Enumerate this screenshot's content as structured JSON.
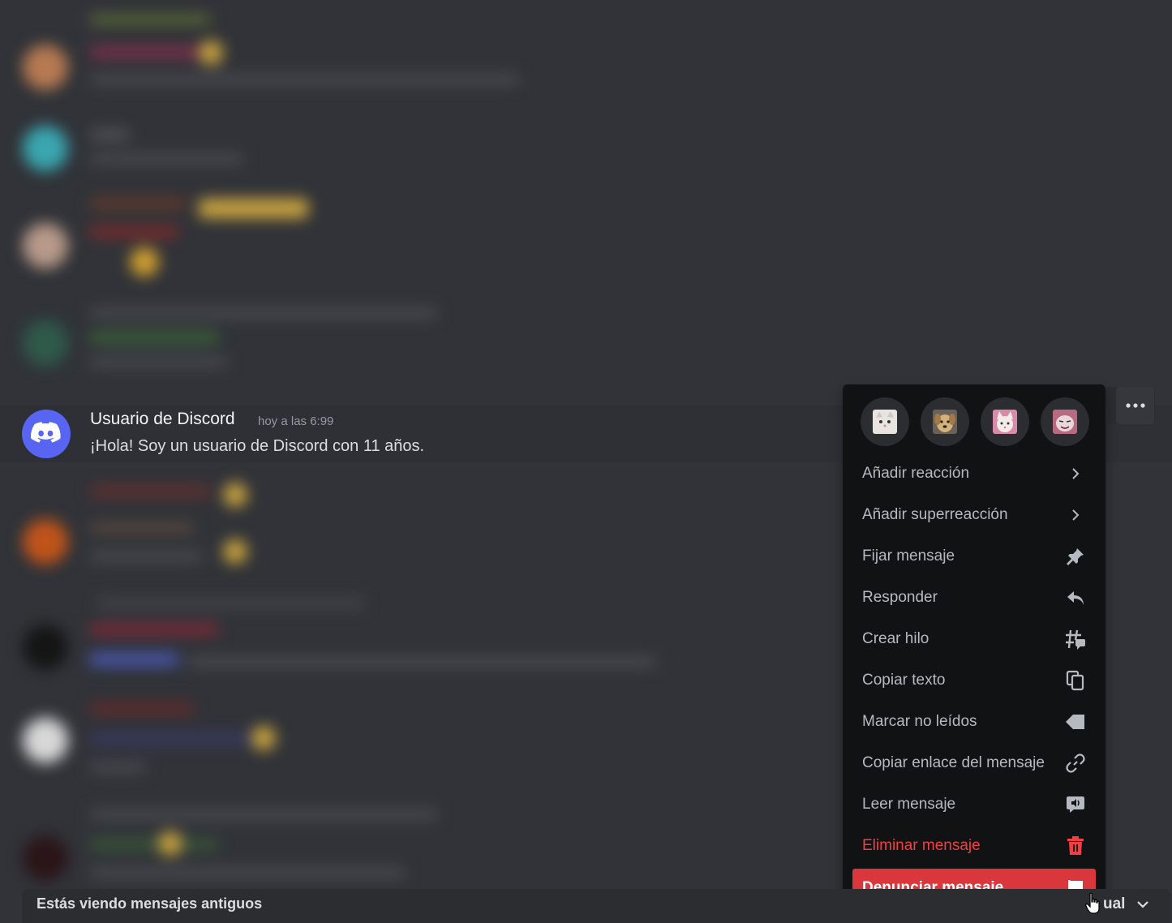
{
  "message": {
    "username": "Usuario de Discord",
    "timestamp": "hoy a las 6:99",
    "text": "¡Hola! Soy un usuario de Discord con 11 años."
  },
  "toolbar": {
    "more_icon": "more-dots-icon"
  },
  "context_menu": {
    "reactions": [
      {
        "icon": "cat-face-emoji"
      },
      {
        "icon": "dog-emoji"
      },
      {
        "icon": "cat-sticker-emoji"
      },
      {
        "icon": "cat-smirk-emoji"
      }
    ],
    "items": [
      {
        "label": "Añadir reacción",
        "icon": "chevron-right-icon"
      },
      {
        "label": "Añadir superreacción",
        "icon": "chevron-right-icon"
      },
      {
        "label": "Fijar mensaje",
        "icon": "pin-icon"
      },
      {
        "label": "Responder",
        "icon": "reply-icon"
      },
      {
        "label": "Crear hilo",
        "icon": "thread-icon"
      },
      {
        "label": "Copiar texto",
        "icon": "copy-icon"
      },
      {
        "label": "Marcar no leídos",
        "icon": "mark-unread-icon"
      },
      {
        "label": "Copiar enlace del mensaje",
        "icon": "link-icon"
      },
      {
        "label": "Leer mensaje",
        "icon": "speaker-icon"
      },
      {
        "label": "Eliminar mensaje",
        "icon": "trash-icon",
        "style": "danger"
      },
      {
        "label": "Denunciar mensaje",
        "icon": "flag-icon",
        "style": "active"
      }
    ]
  },
  "banner": {
    "text": "Estás viendo mensajes antiguos",
    "right_text": "ual"
  },
  "colors": {
    "background": "#313338",
    "menu_bg": "#111214",
    "danger": "#f23f42",
    "active_bg": "#da373c",
    "blurple": "#5865f2"
  }
}
